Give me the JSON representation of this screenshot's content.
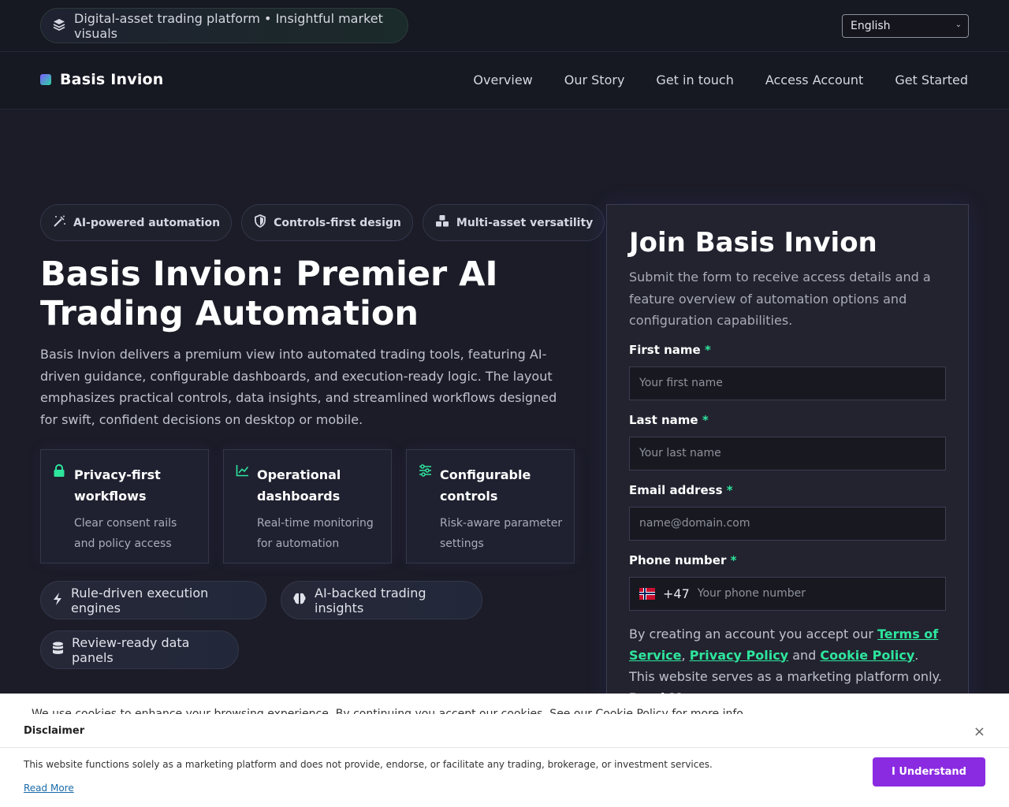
{
  "topbar": {
    "tagline": "Digital-asset trading platform • Insightful market visuals",
    "language": "English"
  },
  "navbar": {
    "brand": "Basis Invion",
    "links": [
      "Overview",
      "Our Story",
      "Get in touch",
      "Access Account",
      "Get Started"
    ]
  },
  "hero": {
    "pills": [
      "AI-powered automation",
      "Controls-first design",
      "Multi-asset versatility"
    ],
    "title": "Basis Invion: Premier AI Trading Automation",
    "description": "Basis Invion delivers a premium view into automated trading tools, featuring AI-driven guidance, configurable dashboards, and execution-ready logic. The layout emphasizes practical controls, data insights, and streamlined workflows designed for swift, confident decisions on desktop or mobile.",
    "features": [
      {
        "title": "Privacy-first workflows",
        "text": "Clear consent rails and policy access",
        "icon": "lock-icon"
      },
      {
        "title": "Operational dash­boards",
        "text": "Real-time monitoring for automation",
        "icon": "chart-line-icon"
      },
      {
        "title": "Configurable con­trols",
        "text": "Risk-aware parame­ter settings",
        "icon": "sliders-icon"
      }
    ],
    "chips": [
      "Rule-driven execution engines",
      "AI-backed trading insights",
      "Review-ready data panels"
    ]
  },
  "form": {
    "title": "Join Basis Invion",
    "subtitle": "Submit the form to receive access details and a fea­ture overview of automation options and configura­tion capabilities.",
    "first_name_label": "First name",
    "first_name_placeholder": "Your first name",
    "last_name_label": "Last name",
    "last_name_placeholder": "Your last name",
    "email_label": "Email address",
    "email_placeholder": "name@domain.com",
    "phone_label": "Phone number",
    "phone_code": "+47",
    "phone_placeholder": "Your phone number",
    "required_mark": "*",
    "terms_prefix": "By creating an account you accept our ",
    "terms_link": "Terms of Service",
    "privacy_link": "Privacy Policy",
    "and": " and ",
    "cookie_link": "Cookie Policy",
    "terms_suffix": ". This web­site serves as a marketing platform only. ",
    "read_more": "Read More"
  },
  "cookie_strip": {
    "text": "We use cookies to enhance your browsing experience. By continuing you accept our cookies. See our Cookie Policy for more info"
  },
  "disclaimer": {
    "title": "Disclaimer",
    "text": "This website functions solely as a marketing platform and does not provide, endorse, or facilitate any trading, brokerage, or investment services.",
    "read_more": "Read More",
    "button": "I Understand",
    "close": "×"
  },
  "colors": {
    "accent_green": "#2ee59d",
    "accent_purple": "#8a2be2",
    "background": "#1b1c27"
  }
}
